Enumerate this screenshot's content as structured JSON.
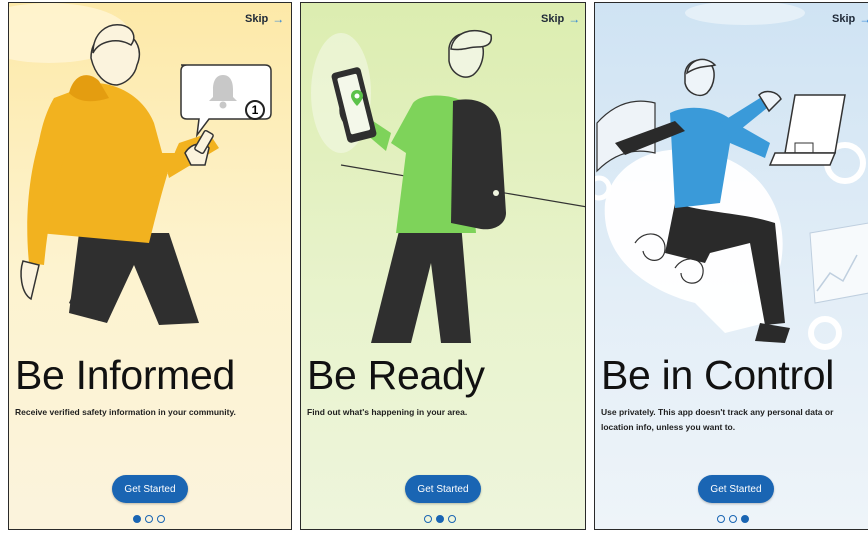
{
  "screens": [
    {
      "skip_label": "Skip",
      "title": "Be Informed",
      "description": "Receive verified safety information in your community.",
      "cta_label": "Get Started",
      "notification_count": "1",
      "active_page": 1,
      "page_count": 3,
      "background_color": "#fdf3cf"
    },
    {
      "skip_label": "Skip",
      "title": "Be Ready",
      "description": "Find out what's happening in your area.",
      "cta_label": "Get Started",
      "active_page": 2,
      "page_count": 3,
      "background_color": "#e8f3cc"
    },
    {
      "skip_label": "Skip",
      "title": "Be in Control",
      "description": "Use privately. This app doesn't track any personal data or location info, unless you want to.",
      "cta_label": "Get Started",
      "active_page": 3,
      "page_count": 3,
      "background_color": "#e3eef7"
    }
  ],
  "colors": {
    "primary": "#1a65b3",
    "skip_arrow": "#2b83d6",
    "hoodie_yellow": "#f2b21f",
    "shirt_green": "#7ed35a",
    "shirt_blue": "#3a9ad9"
  }
}
